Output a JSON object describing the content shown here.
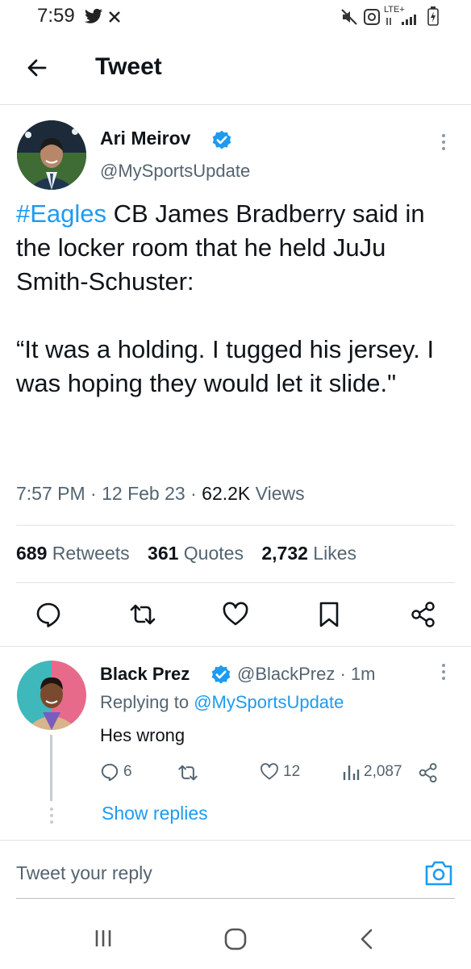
{
  "status_bar": {
    "time": "7:59",
    "network_label": "LTE+"
  },
  "header": {
    "title": "Tweet"
  },
  "tweet": {
    "author_name": "Ari Meirov",
    "author_handle": "@MySportsUpdate",
    "hashtag": "#Eagles",
    "text_line1_rest": " CB James Bradberry said in the locker room that he held JuJu Smith-Schuster:",
    "quote": "“It was a holding. I tugged his jersey. I was hoping they would let it slide.\"",
    "time": "7:57 PM",
    "date": "12 Feb 23",
    "views_count": "62.2K",
    "views_label": "Views",
    "retweets_count": "689",
    "retweets_label": "Retweets",
    "quotes_count": "361",
    "quotes_label": "Quotes",
    "likes_count": "2,732",
    "likes_label": "Likes"
  },
  "reply": {
    "author_name": "Black Prez",
    "author_handle": "@BlackPrez",
    "age": "1m",
    "replying_prefix": "Replying to",
    "replying_to": "@MySportsUpdate",
    "text": "Hes wrong",
    "reply_count": "6",
    "like_count": "12",
    "view_count": "2,087"
  },
  "show_replies_label": "Show replies",
  "compose": {
    "placeholder": "Tweet your reply"
  },
  "colors": {
    "accent": "#1d9bf0",
    "text": "#0f1419",
    "secondary": "#536471"
  }
}
